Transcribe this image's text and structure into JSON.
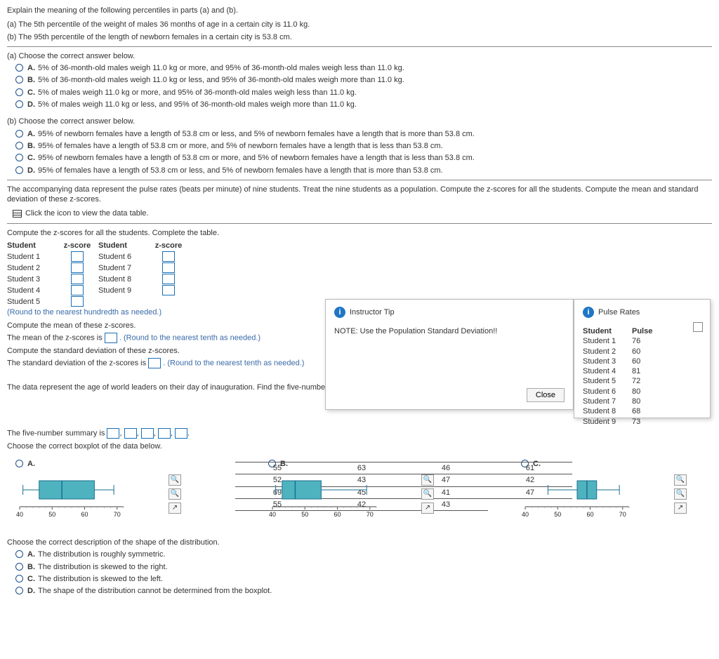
{
  "q1": {
    "prompt": "Explain the meaning of the following percentiles in parts (a) and (b).",
    "line_a": "(a) The 5th percentile of the weight of males 36 months of age in a certain city is 11.0 kg.",
    "line_b": "(b) The 95th percentile of the length of newborn females in a certain city is 53.8 cm.",
    "part_a_head": "(a) Choose the correct answer below.",
    "a_options": {
      "A": "5% of 36-month-old males weigh 11.0 kg or more, and 95% of 36-month-old males weigh less than 11.0 kg.",
      "B": "5% of 36-month-old males weigh 11.0 kg or less, and 95% of 36-month-old males weigh more than 11.0 kg.",
      "C": "5% of males weigh 11.0 kg or more, and 95% of 36-month-old males weigh less than 11.0 kg.",
      "D": "5% of males weigh 11.0 kg or less, and 95% of 36-month-old males weigh more than 11.0 kg."
    },
    "part_b_head": "(b) Choose the correct answer below.",
    "b_options": {
      "A": "95% of newborn females have a length of 53.8 cm or less, and 5% of newborn females have a length that is more than 53.8 cm.",
      "B": "95% of females have a length of 53.8 cm or more, and 5% of newborn females have a length that is less than 53.8 cm.",
      "C": "95% of newborn females have a length of 53.8 cm or more, and 5% of newborn females have a length that is less than 53.8 cm.",
      "D": "95% of females have a length of 53.8 cm or less, and 5% of newborn females have a length that is more than 53.8 cm."
    }
  },
  "q2": {
    "prompt": "The accompanying data represent the pulse rates (beats per minute) of nine students. Treat the nine students as a population. Compute the z-scores for all the students. Compute the mean and standard deviation of these z-scores.",
    "link": "Click the icon to view the data table.",
    "head": "Compute the z-scores for all the students. Complete the table.",
    "cols": {
      "c1": "Student",
      "c2": "z-score",
      "c3": "Student",
      "c4": "z-score"
    },
    "students_left": [
      "Student 1",
      "Student 2",
      "Student 3",
      "Student 4",
      "Student 5"
    ],
    "students_right": [
      "Student 6",
      "Student 7",
      "Student 8",
      "Student 9"
    ],
    "round1": "(Round to the nearest hundredth as needed.)",
    "mean_head": "Compute the mean of these z-scores.",
    "mean_line1": "The mean of the z-scores is ",
    "mean_line2": ". (Round to the nearest tenth as needed.)",
    "sd_head": "Compute the standard deviation of these z-scores.",
    "sd_line1": "The standard deviation of the z-scores is ",
    "sd_line2": ". (Round to the nearest tenth as needed.)"
  },
  "tip": {
    "title": "Instructor Tip",
    "body": "NOTE: Use the Population Standard Deviation!!",
    "close": "Close"
  },
  "pulse": {
    "title": "Pulse Rates",
    "h1": "Student",
    "h2": "Pulse",
    "data": [
      [
        "Student 1",
        "76"
      ],
      [
        "Student 2",
        "60"
      ],
      [
        "Student 3",
        "60"
      ],
      [
        "Student 4",
        "81"
      ],
      [
        "Student 5",
        "72"
      ],
      [
        "Student 6",
        "80"
      ],
      [
        "Student 7",
        "80"
      ],
      [
        "Student 8",
        "68"
      ],
      [
        "Student 9",
        "73"
      ]
    ]
  },
  "q3": {
    "prompt": "The data represent the age of world leaders on their day of inauguration. Find the five-number summary, and construct a boxplot for the data. Comment on the shape of the distribution.",
    "grid": [
      [
        "55",
        "63",
        "46",
        "61"
      ],
      [
        "52",
        "43",
        "47",
        "42"
      ],
      [
        "69",
        "45",
        "41",
        "47"
      ],
      [
        "55",
        "42",
        "43",
        ""
      ]
    ],
    "summary_label": "The five-number summary is ",
    "boxplot_head": "Choose the correct boxplot of the data below.",
    "optA": "A.",
    "optB": "B.",
    "optC": "C.",
    "axis": [
      "40",
      "50",
      "60",
      "70"
    ],
    "shape_head": "Choose the correct description of the shape of the distribution.",
    "shape_options": {
      "A": "The distribution is roughly symmetric.",
      "B": "The distribution is skewed to the right.",
      "C": "The distribution is skewed to the left.",
      "D": "The shape of the distribution cannot be determined from the boxplot."
    }
  },
  "chart_data": [
    {
      "type": "boxplot",
      "label": "Option A",
      "min": 41,
      "q1": 46,
      "median": 53,
      "q3": 63,
      "max": 69,
      "xlim": [
        40,
        72
      ],
      "ticks": [
        40,
        50,
        60,
        70
      ]
    },
    {
      "type": "boxplot",
      "label": "Option B",
      "min": 41,
      "q1": 43,
      "median": 47,
      "q3": 55,
      "max": 69,
      "xlim": [
        40,
        72
      ],
      "ticks": [
        40,
        50,
        60,
        70
      ]
    },
    {
      "type": "boxplot",
      "label": "Option C",
      "min": 47,
      "q1": 56,
      "median": 59,
      "q3": 62,
      "max": 69,
      "xlim": [
        40,
        72
      ],
      "ticks": [
        40,
        50,
        60,
        70
      ]
    }
  ]
}
